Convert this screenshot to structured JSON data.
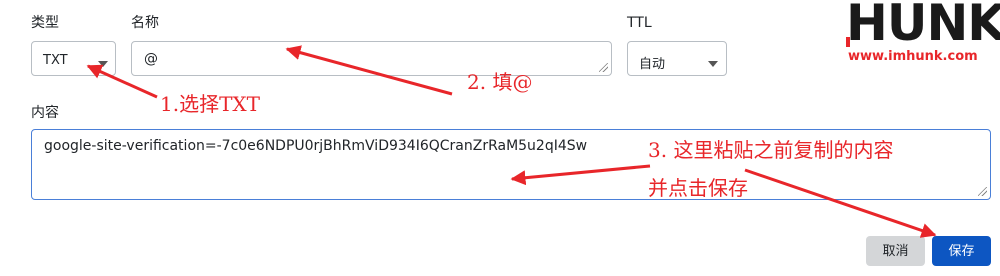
{
  "form": {
    "type_label": "类型",
    "type_value": "TXT",
    "name_label": "名称",
    "name_value": "@",
    "ttl_label": "TTL",
    "ttl_value": "自动",
    "content_label": "内容",
    "content_value": "google-site-verification=-7c0e6NDPU0rjBhRmViD934I6QCranZrRaM5u2qI4Sw"
  },
  "buttons": {
    "cancel_label": "取消",
    "save_label": "保存"
  },
  "annotations": {
    "step1": "1.选择TXT",
    "step2": "2. 填@",
    "step3_line1": "3. 这里粘贴之前复制的内容",
    "step3_line2": "并点击保存"
  },
  "logo": {
    "word": "HUNK",
    "url": "www.imhunk.com"
  },
  "colors": {
    "annotation_red": "#e8262a",
    "primary_blue": "#0d56c2",
    "focus_border": "#4a7fd8",
    "cancel_gray": "#d4d6d8"
  }
}
